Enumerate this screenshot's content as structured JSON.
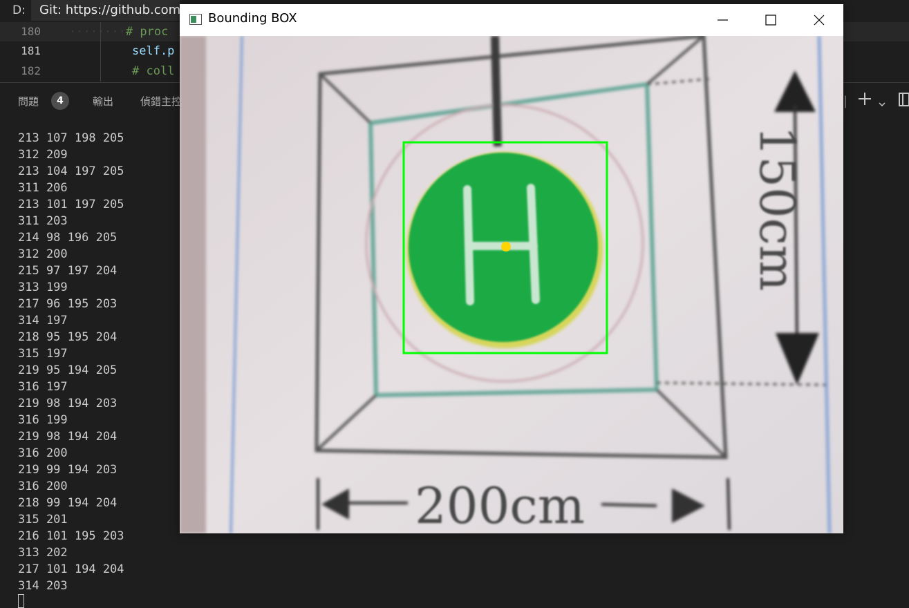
{
  "top": {
    "drive_letter": "D:",
    "tooltip": "Git: https://github.com"
  },
  "editor": {
    "lines": [
      {
        "number": "180",
        "code": "# proc"
      },
      {
        "number": "181",
        "code": "self.p"
      },
      {
        "number": "182",
        "code": "# coll"
      }
    ]
  },
  "panel": {
    "tabs": {
      "problems": "問題",
      "problems_count": "4",
      "output": "輸出",
      "debug_console": "偵錯主控"
    },
    "icons": [
      "split-icon",
      "add-terminal-icon",
      "chevron-down-icon",
      "panel-layout-icon"
    ]
  },
  "terminal": {
    "lines": [
      "213 107 198 205",
      "312 209",
      "213 104 197 205",
      "311 206",
      "213 101 197 205",
      "311 203",
      "214 98 196 205",
      "312 200",
      "215 97 197 204",
      "313 199",
      "217 96 195 203",
      "314 197",
      "218 95 195 204",
      "315 197",
      "219 95 194 205",
      "316 197",
      "219 98 194 203",
      "316 199",
      "219 98 194 204",
      "316 200",
      "219 99 194 203",
      "316 200",
      "218 99 194 204",
      "315 201",
      "216 101 195 203",
      "313 202",
      "217 101 194 204",
      "314 203"
    ]
  },
  "window": {
    "title": "Bounding BOX",
    "image": {
      "label_vertical": "150cm",
      "label_horizontal": "200cm",
      "marker_letter": "H",
      "bbox_color": "#00ff00",
      "center_dot_color": "#ffd400",
      "helipad_color": "#1faa44"
    }
  }
}
